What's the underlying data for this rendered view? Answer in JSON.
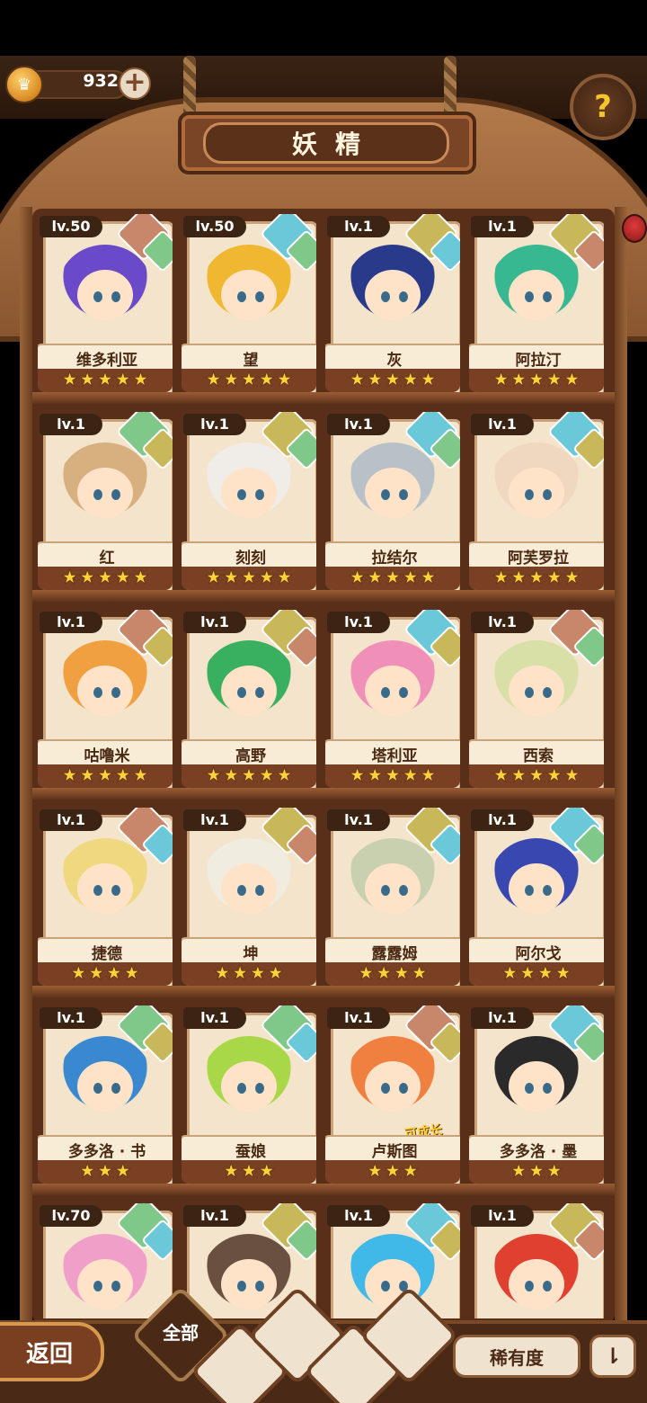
{
  "header": {
    "currency_value": "932",
    "currency_plus": "+",
    "title": "妖精",
    "help_icon": "question-sprout-icon"
  },
  "sprites": [
    {
      "level": "lv.50",
      "name": "维多利亚",
      "stars": "★★★★★",
      "badges": [
        "#c8866a",
        "#7fc88a"
      ],
      "hair": "#6a4ac8"
    },
    {
      "level": "lv.50",
      "name": "望",
      "stars": "★★★★★",
      "badges": [
        "#6ac8d8",
        "#7fc88a"
      ],
      "hair": "#f0b830"
    },
    {
      "level": "lv.1",
      "name": "灰",
      "stars": "★★★★★",
      "badges": [
        "#c8b85a",
        "#6ac8d8"
      ],
      "hair": "#2a3a8a"
    },
    {
      "level": "lv.1",
      "name": "阿拉汀",
      "stars": "★★★★★",
      "badges": [
        "#c8b85a",
        "#c8866a"
      ],
      "hair": "#38b890"
    },
    {
      "level": "lv.1",
      "name": "红",
      "stars": "★★★★★",
      "badges": [
        "#7fc88a",
        "#c8b85a"
      ],
      "hair": "#d8b080"
    },
    {
      "level": "lv.1",
      "name": "刻刻",
      "stars": "★★★★★",
      "badges": [
        "#c8b85a",
        "#7fc88a"
      ],
      "hair": "#f0ece8"
    },
    {
      "level": "lv.1",
      "name": "拉结尔",
      "stars": "★★★★★",
      "badges": [
        "#6ac8d8",
        "#7fc88a"
      ],
      "hair": "#b8c0c8"
    },
    {
      "level": "lv.1",
      "name": "阿芙罗拉",
      "stars": "★★★★★",
      "badges": [
        "#6ac8d8",
        "#c8b85a"
      ],
      "hair": "#f0d8c0"
    },
    {
      "level": "lv.1",
      "name": "咕噜米",
      "stars": "★★★★★",
      "badges": [
        "#c8866a",
        "#c8b85a"
      ],
      "hair": "#f0a040"
    },
    {
      "level": "lv.1",
      "name": "高野",
      "stars": "★★★★★",
      "badges": [
        "#c8b85a",
        "#c8866a"
      ],
      "hair": "#38b060"
    },
    {
      "level": "lv.1",
      "name": "塔利亚",
      "stars": "★★★★★",
      "badges": [
        "#6ac8d8",
        "#c8b85a"
      ],
      "hair": "#f090b8"
    },
    {
      "level": "lv.1",
      "name": "西索",
      "stars": "★★★★★",
      "badges": [
        "#c8866a",
        "#7fc88a"
      ],
      "hair": "#d8e0a8"
    },
    {
      "level": "lv.1",
      "name": "捷德",
      "stars": "★★★★",
      "badges": [
        "#c8866a",
        "#6ac8d8"
      ],
      "hair": "#f0d880"
    },
    {
      "level": "lv.1",
      "name": "坤",
      "stars": "★★★★",
      "badges": [
        "#c8b85a",
        "#c8866a"
      ],
      "hair": "#f0ece0"
    },
    {
      "level": "lv.1",
      "name": "露露姆",
      "stars": "★★★★",
      "badges": [
        "#c8b85a",
        "#6ac8d8"
      ],
      "hair": "#c8d0b0"
    },
    {
      "level": "lv.1",
      "name": "阿尔戈",
      "stars": "★★★★",
      "badges": [
        "#6ac8d8",
        "#7fc88a"
      ],
      "hair": "#3848b0"
    },
    {
      "level": "lv.1",
      "name": "多多洛 · 书",
      "stars": "★★★",
      "badges": [
        "#7fc88a",
        "#c8b85a"
      ],
      "hair": "#3a88d0"
    },
    {
      "level": "lv.1",
      "name": "蚕娘",
      "stars": "★★★",
      "badges": [
        "#7fc88a",
        "#6ac8d8"
      ],
      "hair": "#a8d848"
    },
    {
      "level": "lv.1",
      "name": "卢斯图",
      "stars": "★★★",
      "badges": [
        "#c8866a",
        "#c8b85a"
      ],
      "hair": "#f08040",
      "tag": "可成长"
    },
    {
      "level": "lv.1",
      "name": "多多洛 · 墨",
      "stars": "★★★",
      "badges": [
        "#6ac8d8",
        "#7fc88a"
      ],
      "hair": "#2a2a2a"
    },
    {
      "level": "lv.70",
      "name": "",
      "stars": "",
      "badges": [
        "#7fc88a",
        "#6ac8d8"
      ],
      "hair": "#f0a0c8"
    },
    {
      "level": "lv.1",
      "name": "",
      "stars": "",
      "badges": [
        "#c8b85a",
        "#7fc88a"
      ],
      "hair": "#6a5040"
    },
    {
      "level": "lv.1",
      "name": "",
      "stars": "",
      "badges": [
        "#6ac8d8",
        "#c8b85a"
      ],
      "hair": "#40b8e8"
    },
    {
      "level": "lv.1",
      "name": "",
      "stars": "",
      "badges": [
        "#c8b85a",
        "#c8866a"
      ],
      "hair": "#e04030"
    }
  ],
  "footer": {
    "back_label": "返回",
    "filter_all_label": "全部",
    "sort_label": "稀有度",
    "order_icon": "sort-order-icon"
  },
  "colors": {
    "wood": "#6b3f22",
    "paper": "#f4e4cb",
    "star": "#ffd23a"
  }
}
